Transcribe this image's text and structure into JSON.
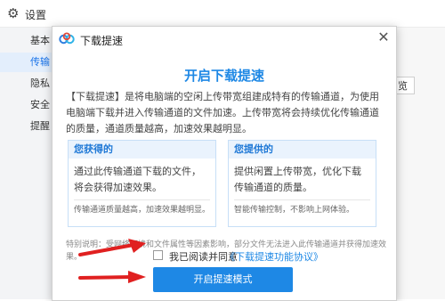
{
  "background_window": {
    "title": "设置",
    "icon": "gear-icon",
    "sidebar": [
      {
        "label": "基本",
        "active": false
      },
      {
        "label": "传输",
        "active": true
      },
      {
        "label": "隐私",
        "active": false
      },
      {
        "label": "安全",
        "active": false
      },
      {
        "label": "提醒",
        "active": false
      }
    ],
    "right_button_fragment": "览"
  },
  "dialog": {
    "title": "下载提速",
    "logo_icon": "baidu-netdisk-logo-icon",
    "close_icon": "close-icon",
    "heading": "开启下载提速",
    "description": "【下载提速】是将电脑端的空闲上传带宽组建成特有的传输通道，为使用电脑端下载并进入传输通道的文件加速。上传带宽将会持续优化传输通道的质量，通道质量越高，加速效果越明显。",
    "cards": [
      {
        "title": "您获得的",
        "body": "通过此传输通道下载的文件，将会获得加速效果。",
        "footnote": "传输通道质量越高，加速效果越明显。"
      },
      {
        "title": "您提供的",
        "body": "提供闲置上传带宽，优化下载传输通道的质量。",
        "footnote": "智能传输控制，不影响上网体验。"
      }
    ],
    "note": "特别说明：受网络环境和文件属性等因素影响，部分文件无法进入此传输通道并获得加速效果。",
    "agree_label": "我已阅读并同意",
    "agree_link": "《下载提速功能协议》",
    "agree_checked": false,
    "primary_button": "开启提速模式"
  },
  "colors": {
    "accent": "#1e88e5",
    "annotation": "#e02020"
  }
}
